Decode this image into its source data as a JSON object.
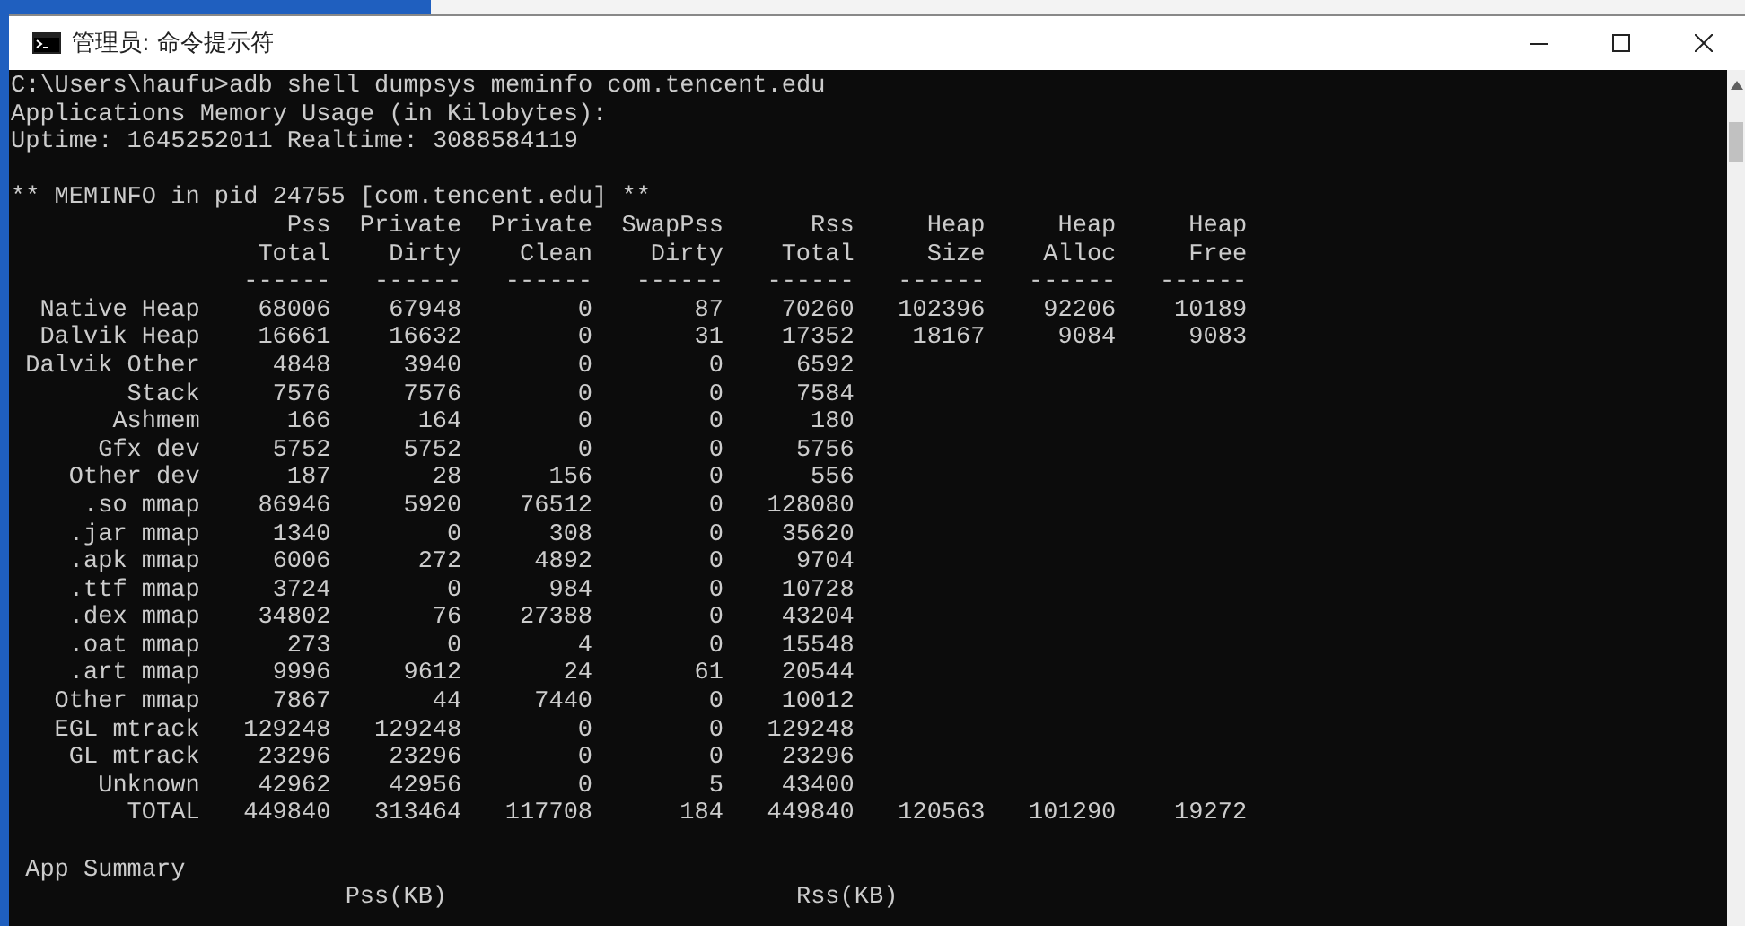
{
  "window": {
    "title": "管理员: 命令提示符"
  },
  "console": {
    "lines_before": [
      "C:\\Users\\haufu>adb shell dumpsys meminfo com.tencent.edu",
      "Applications Memory Usage (in Kilobytes):",
      "Uptime: 1645252011 Realtime: 3088584119"
    ],
    "heading": "** MEMINFO in pid 24755 [com.tencent.edu] **",
    "table": {
      "columns": [
        {
          "line1": "Pss",
          "line2": "Total",
          "rule": "------"
        },
        {
          "line1": "Private",
          "line2": "Dirty",
          "rule": "------"
        },
        {
          "line1": "Private",
          "line2": "Clean",
          "rule": "------"
        },
        {
          "line1": "SwapPss",
          "line2": "Dirty",
          "rule": "------"
        },
        {
          "line1": "Rss",
          "line2": "Total",
          "rule": "------"
        },
        {
          "line1": "Heap",
          "line2": "Size",
          "rule": "------"
        },
        {
          "line1": "Heap",
          "line2": "Alloc",
          "rule": "------"
        },
        {
          "line1": "Heap",
          "line2": "Free",
          "rule": "------"
        }
      ],
      "rows": [
        {
          "label": "Native Heap",
          "values": [
            "68006",
            "67948",
            "0",
            "87",
            "70260",
            "102396",
            "92206",
            "10189"
          ]
        },
        {
          "label": "Dalvik Heap",
          "values": [
            "16661",
            "16632",
            "0",
            "31",
            "17352",
            "18167",
            "9084",
            "9083"
          ]
        },
        {
          "label": "Dalvik Other",
          "values": [
            "4848",
            "3940",
            "0",
            "0",
            "6592"
          ]
        },
        {
          "label": "Stack",
          "values": [
            "7576",
            "7576",
            "0",
            "0",
            "7584"
          ]
        },
        {
          "label": "Ashmem",
          "values": [
            "166",
            "164",
            "0",
            "0",
            "180"
          ]
        },
        {
          "label": "Gfx dev",
          "values": [
            "5752",
            "5752",
            "0",
            "0",
            "5756"
          ]
        },
        {
          "label": "Other dev",
          "values": [
            "187",
            "28",
            "156",
            "0",
            "556"
          ]
        },
        {
          "label": ".so mmap",
          "values": [
            "86946",
            "5920",
            "76512",
            "0",
            "128080"
          ]
        },
        {
          "label": ".jar mmap",
          "values": [
            "1340",
            "0",
            "308",
            "0",
            "35620"
          ]
        },
        {
          "label": ".apk mmap",
          "values": [
            "6006",
            "272",
            "4892",
            "0",
            "9704"
          ]
        },
        {
          "label": ".ttf mmap",
          "values": [
            "3724",
            "0",
            "984",
            "0",
            "10728"
          ]
        },
        {
          "label": ".dex mmap",
          "values": [
            "34802",
            "76",
            "27388",
            "0",
            "43204"
          ]
        },
        {
          "label": ".oat mmap",
          "values": [
            "273",
            "0",
            "4",
            "0",
            "15548"
          ]
        },
        {
          "label": ".art mmap",
          "values": [
            "9996",
            "9612",
            "24",
            "61",
            "20544"
          ]
        },
        {
          "label": "Other mmap",
          "values": [
            "7867",
            "44",
            "7440",
            "0",
            "10012"
          ]
        },
        {
          "label": "EGL mtrack",
          "values": [
            "129248",
            "129248",
            "0",
            "0",
            "129248"
          ]
        },
        {
          "label": "GL mtrack",
          "values": [
            "23296",
            "23296",
            "0",
            "0",
            "23296"
          ]
        },
        {
          "label": "Unknown",
          "values": [
            "42962",
            "42956",
            "0",
            "5",
            "43400"
          ]
        },
        {
          "label": "TOTAL",
          "values": [
            "449840",
            "313464",
            "117708",
            "184",
            "449840",
            "120563",
            "101290",
            "19272"
          ]
        }
      ]
    },
    "summary": {
      "title": "App Summary",
      "columns": [
        "Pss(KB)",
        "Rss(KB)"
      ]
    }
  }
}
